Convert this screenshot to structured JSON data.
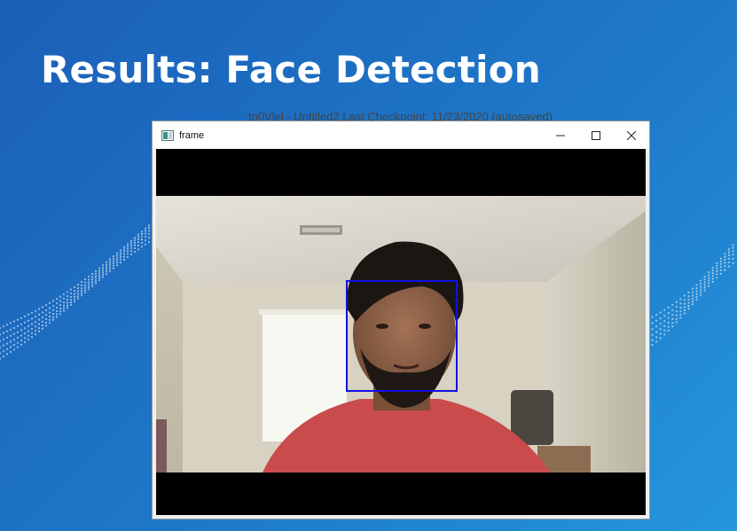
{
  "slide": {
    "title": "Results: Face Detection"
  },
  "background_window": {
    "title_fragment": "to0Vlel - Untitled2  Last Checkpoint: 11/23/2020  (autosaved)"
  },
  "window": {
    "title": "frame",
    "icon": "opencv-window-icon",
    "minimize_glyph": "—",
    "maximize_glyph": "☐",
    "close_glyph": "✕"
  },
  "detection": {
    "box_color": "#1010e6",
    "label": "face"
  },
  "colors": {
    "bg_start": "#1b5fb8",
    "bg_end": "#2596dc",
    "title_text": "#ffffff"
  }
}
